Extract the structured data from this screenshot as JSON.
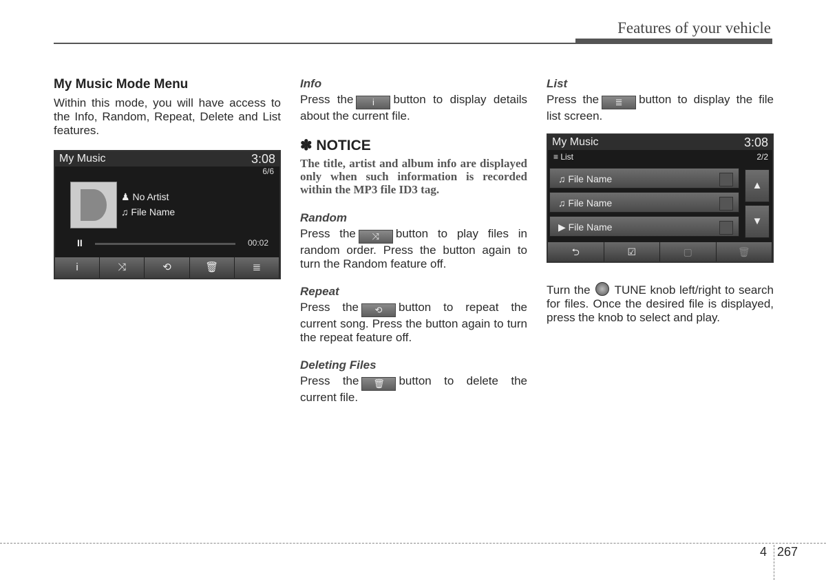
{
  "header": {
    "title": "Features of your vehicle"
  },
  "col1": {
    "heading": "My Music Mode Menu",
    "text": "Within this mode, you will have access to the Info, Random, Repeat, Delete and List features."
  },
  "screen1": {
    "title": "My Music",
    "clock": "3:08",
    "count": "6/6",
    "artist": "No Artist",
    "file": "File Name",
    "time": "00:02",
    "buttons": [
      "i",
      "⤨",
      "⟲",
      "🗑",
      "≣"
    ]
  },
  "info": {
    "title": "Info",
    "pre": "Press the",
    "btn": "i",
    "post": "button to display details about the current file."
  },
  "notice": {
    "title": "✽ NOTICE",
    "text": "The title, artist and album info are displayed only when such information is recorded within the MP3 file ID3 tag."
  },
  "random": {
    "title": "Random",
    "pre": "Press the",
    "btn": "⤨",
    "post": "button to play files in random order. Press the button again to turn the Random feature off."
  },
  "repeat": {
    "title": "Repeat",
    "pre": "Press the",
    "btn": "⟲",
    "post": "button to repeat the current song. Press the button again to turn the repeat feature off."
  },
  "delete": {
    "title": "Deleting Files",
    "pre": "Press the",
    "btn": "🗑",
    "post": "button to delete the current file."
  },
  "list": {
    "title": "List",
    "pre": "Press the",
    "btn": "≣",
    "post": "button to display the file list screen."
  },
  "screen2": {
    "title": "My Music",
    "clock": "3:08",
    "list_label": "List",
    "page": "2/2",
    "rows": [
      "File Name",
      "File Name",
      "File Name"
    ],
    "buttons": [
      "⮌",
      "☑",
      "▢",
      "🗑"
    ]
  },
  "tune": {
    "pre": "Turn the",
    "post": "TUNE knob left/right to search for files. Once the desired file is displayed, press the knob to select and play."
  },
  "footer": {
    "chapter": "4",
    "page": "267"
  }
}
